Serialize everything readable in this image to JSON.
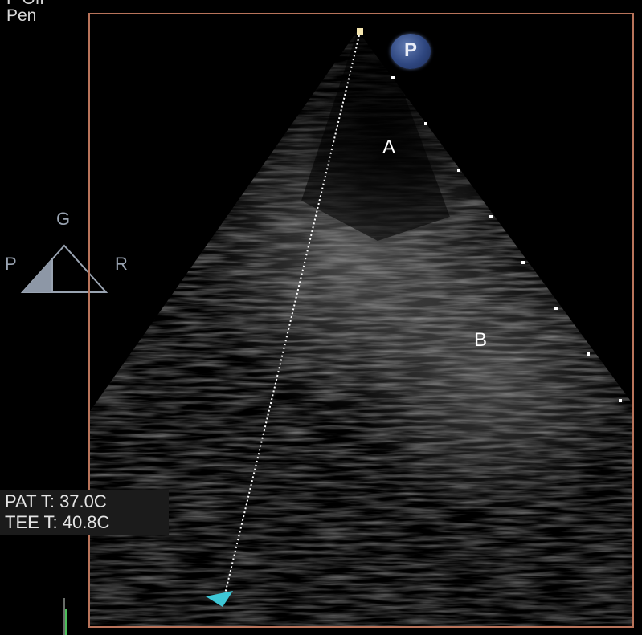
{
  "top_labels": {
    "cut_off": "P Off",
    "pen": "Pen"
  },
  "orientation": {
    "top": "G",
    "left": "P",
    "right": "R"
  },
  "markers": {
    "a": "A",
    "b": "B"
  },
  "badge": {
    "label": "P",
    "color": "#2f4780"
  },
  "temperatures": {
    "patient": "PAT T: 37.0C",
    "tee": "TEE T: 40.8C"
  },
  "colors": {
    "frame_border": "#b8735a",
    "cursor_marker": "#3ec7d6",
    "orientation_glyph": "#9aa4b2",
    "focus_marker": "#f5e6b0"
  },
  "icons": {
    "orientation": "orientation-triangle-icon",
    "cursor_end": "cyan-triangle-icon",
    "focus": "focus-square-icon",
    "scale_bar": "green-scale-bar-icon"
  }
}
